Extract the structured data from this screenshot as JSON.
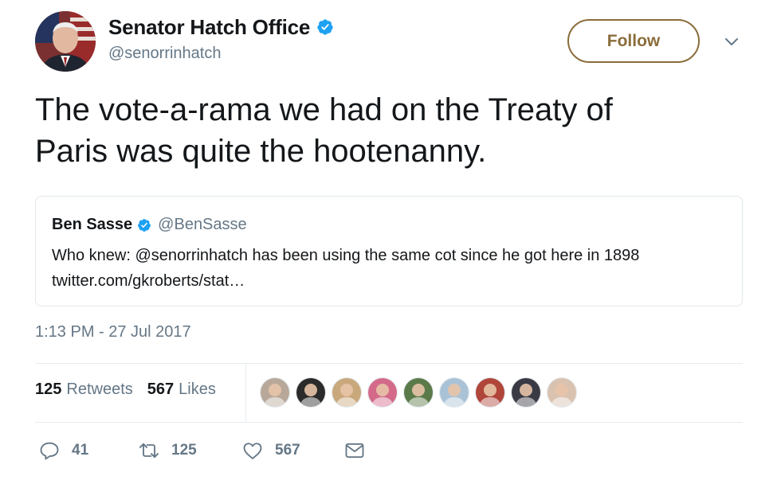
{
  "author": {
    "display_name": "Senator Hatch Office",
    "handle": "@senorrinhatch",
    "verified": true
  },
  "follow_button": {
    "label": "Follow"
  },
  "tweet": {
    "lines": [
      "The vote-a-rama we had on the Treaty of",
      "Paris was quite the hootenanny."
    ]
  },
  "quoted_tweet": {
    "display_name": "Ben Sasse",
    "handle": "@BenSasse",
    "verified": true,
    "lines": [
      "Who knew: @senorrinhatch has been using the same cot since he got here in 1898",
      "twitter.com/gkroberts/stat…"
    ]
  },
  "timestamp": "1:13 PM - 27 Jul 2017",
  "stats": {
    "retweets_count": "125",
    "retweets_label": "Retweets",
    "likes_count": "567",
    "likes_label": "Likes"
  },
  "likers": [
    {
      "name": "liker-1",
      "color": "#b8a89a"
    },
    {
      "name": "liker-2",
      "color": "#2b2b2b"
    },
    {
      "name": "liker-3",
      "color": "#c9a87c"
    },
    {
      "name": "liker-4",
      "color": "#d46a8a"
    },
    {
      "name": "liker-5",
      "color": "#5b7a4a"
    },
    {
      "name": "liker-6",
      "color": "#a9c2d6"
    },
    {
      "name": "liker-7",
      "color": "#b0453a"
    },
    {
      "name": "liker-8",
      "color": "#3a3a44"
    },
    {
      "name": "liker-9",
      "color": "#d9c2b0"
    }
  ],
  "actions": {
    "reply_count": "41",
    "retweet_count": "125",
    "like_count": "567"
  },
  "colors": {
    "verified_blue": "#1da1f2",
    "follow_accent": "#8a6d3b",
    "secondary_text": "#657786",
    "border": "#e1e8ed"
  }
}
